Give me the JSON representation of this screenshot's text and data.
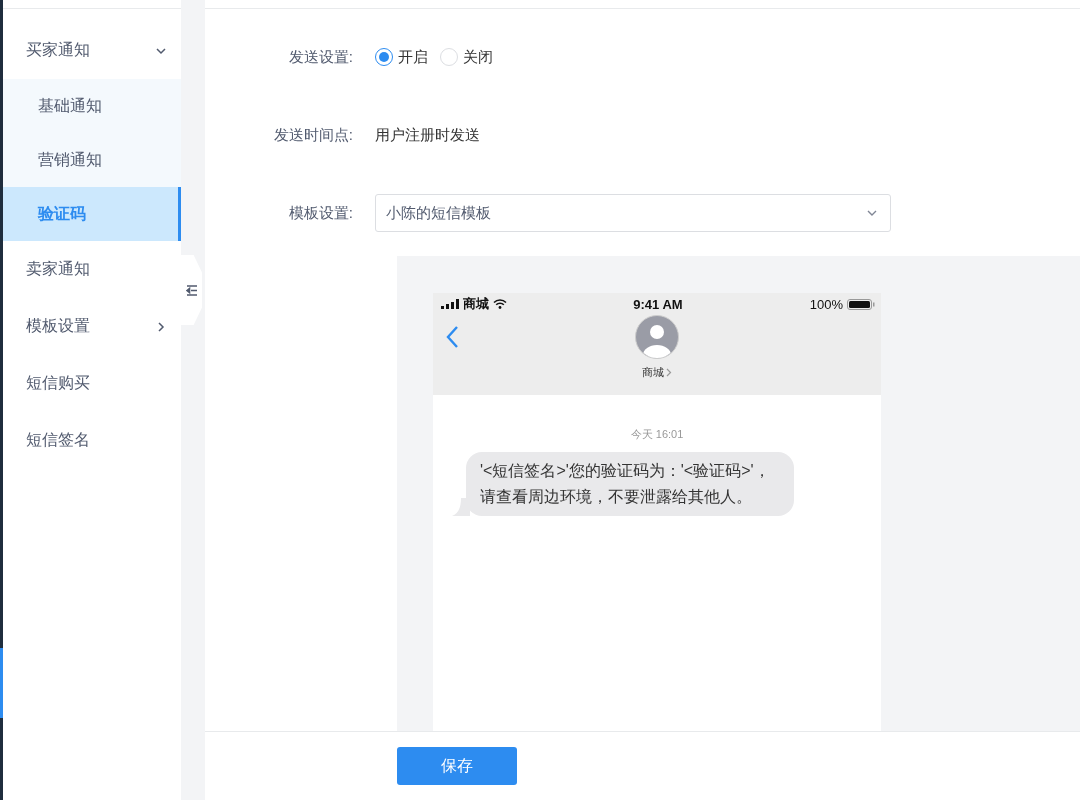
{
  "sidebar": {
    "items": [
      {
        "label": "买家通知",
        "expanded": true,
        "selected": false,
        "children": [
          {
            "label": "基础通知",
            "selected": false
          },
          {
            "label": "营销通知",
            "selected": false
          },
          {
            "label": "验证码",
            "selected": true
          }
        ]
      },
      {
        "label": "卖家通知",
        "selected": false
      },
      {
        "label": "模板设置",
        "expanded": false,
        "selected": false
      },
      {
        "label": "短信购买",
        "selected": false
      },
      {
        "label": "短信签名",
        "selected": false
      }
    ]
  },
  "form": {
    "send_setting": {
      "label": "发送设置:",
      "options": [
        {
          "label": "开启",
          "selected": true
        },
        {
          "label": "关闭",
          "selected": false
        }
      ]
    },
    "send_time": {
      "label": "发送时间点:",
      "value": "用户注册时发送"
    },
    "template": {
      "label": "模板设置:",
      "value": "小陈的短信模板"
    }
  },
  "phone": {
    "carrier": "商城",
    "time": "9:41 AM",
    "battery": "100%",
    "contact": "商城",
    "message_time": "今天 16:01",
    "message": "'<短信签名>'您的验证码为：'<验证码>'，请查看周边环境，不要泄露给其他人。"
  },
  "footer": {
    "save": "保存"
  }
}
